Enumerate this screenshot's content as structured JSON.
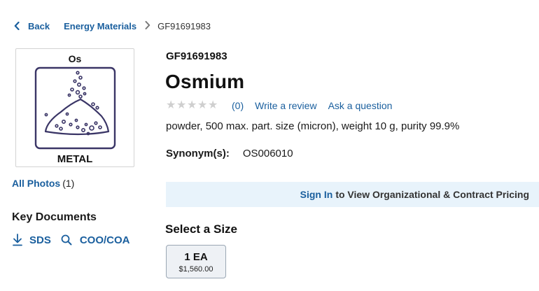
{
  "breadcrumb": {
    "back_label": "Back",
    "category": "Energy Materials",
    "current": "GF91691983"
  },
  "product": {
    "image": {
      "element_symbol": "Os",
      "form_label": "METAL",
      "icon": "powder-pile-icon"
    },
    "all_photos_label": "All Photos",
    "all_photos_count": "(1)",
    "sku": "GF91691983",
    "name": "Osmium",
    "rating": {
      "stars": 0,
      "max_stars": 5,
      "review_count": "(0)",
      "write_review": "Write a review",
      "ask_question": "Ask a question"
    },
    "description": "powder, 500 max. part. size (micron), weight 10 g, purity 99.9%",
    "synonyms_label": "Synonym(s):",
    "synonyms_value": "OS006010"
  },
  "key_documents": {
    "heading": "Key Documents",
    "sds_label": "SDS",
    "coo_label": "COO/COA"
  },
  "pricing_banner": {
    "sign_in": "Sign In",
    "message": "to View Organizational & Contract Pricing"
  },
  "sizes": {
    "heading": "Select a Size",
    "options": [
      {
        "size": "1 EA",
        "price": "$1,560.00"
      }
    ]
  },
  "colors": {
    "link": "#1a5f9e",
    "banner_bg": "#e8f3fb",
    "star_empty": "#cfcfcf",
    "icon_stroke": "#3a3566"
  }
}
